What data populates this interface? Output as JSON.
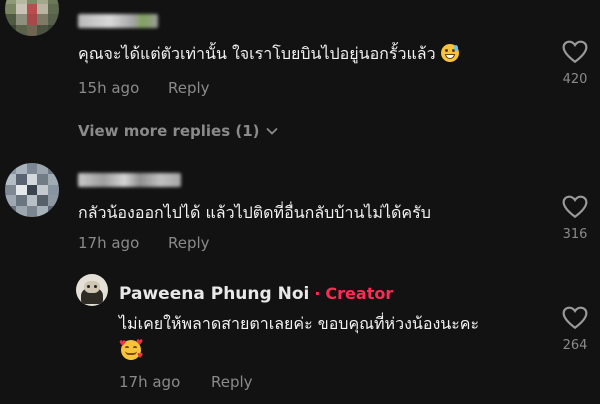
{
  "comments": [
    {
      "text": "คุณจะได้แต่ตัวเท่านั้น ใจเราโบยบินไปอยู่นอกรั้วแล้ว",
      "emoji": "grinning-sweat-emoji",
      "time": "15h ago",
      "reply": "Reply",
      "likes": "420",
      "view_more": "View more replies (1)"
    },
    {
      "text": "กลัวน้องออกไปได้ แล้วไปติดที่อื่นกลับบ้านไม่ได้ครับ",
      "time": "17h ago",
      "reply": "Reply",
      "likes": "316"
    }
  ],
  "creator_reply": {
    "name": "Paweena Phung Noi",
    "separator": "·",
    "badge": "Creator",
    "text": "ไม่เคยให้พลาดสายตาเลยค่ะ ขอบคุณที่ห่วงน้องนะคะ",
    "emoji": "smiling-hearts-emoji",
    "time": "17h ago",
    "reply": "Reply",
    "likes": "264"
  },
  "colors": {
    "background": "#121212",
    "creator_accent": "#fe2c55",
    "secondary_text": "#8a8a8a"
  },
  "icons": [
    "heart-outline-icon",
    "chevron-down-icon"
  ]
}
